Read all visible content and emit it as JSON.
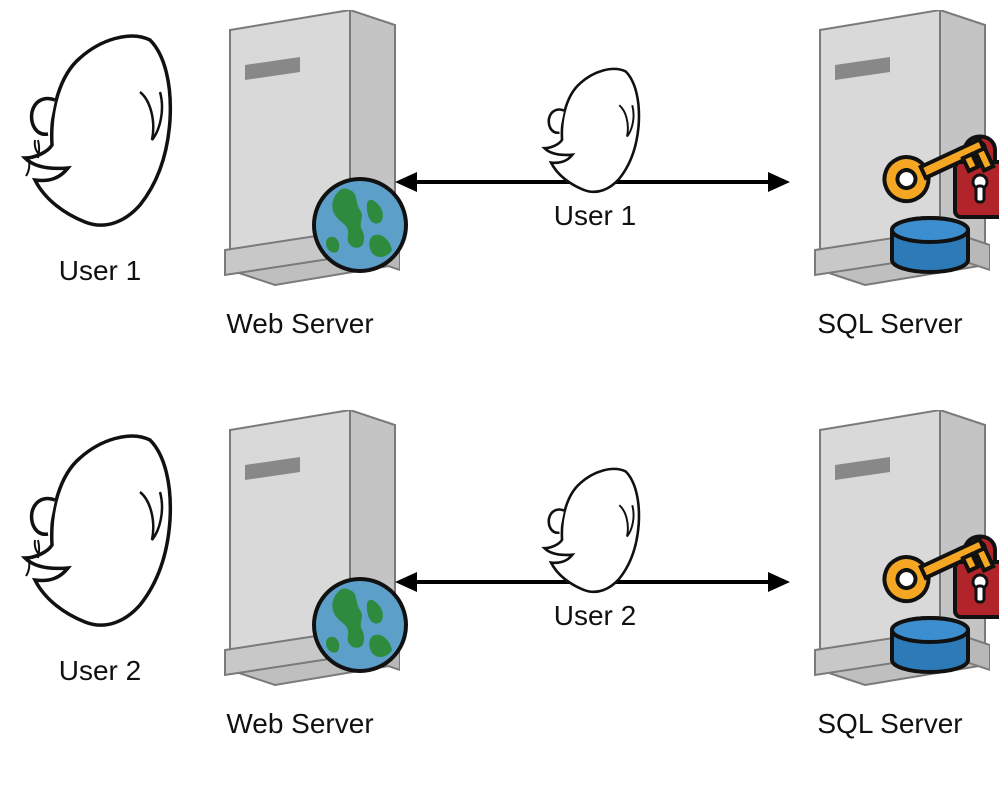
{
  "row1": {
    "left_user_label": "User 1",
    "web_server_label": "Web Server",
    "mid_user_label": "User 1",
    "sql_server_label": "SQL Server"
  },
  "row2": {
    "left_user_label": "User 2",
    "web_server_label": "Web Server",
    "mid_user_label": "User 2",
    "sql_server_label": "SQL Server"
  },
  "icons": {
    "user_head": "user-head-icon",
    "server": "server-icon",
    "globe": "globe-icon",
    "lock": "lock-icon",
    "key": "key-icon",
    "database": "database-icon",
    "arrow": "double-arrow-icon"
  }
}
